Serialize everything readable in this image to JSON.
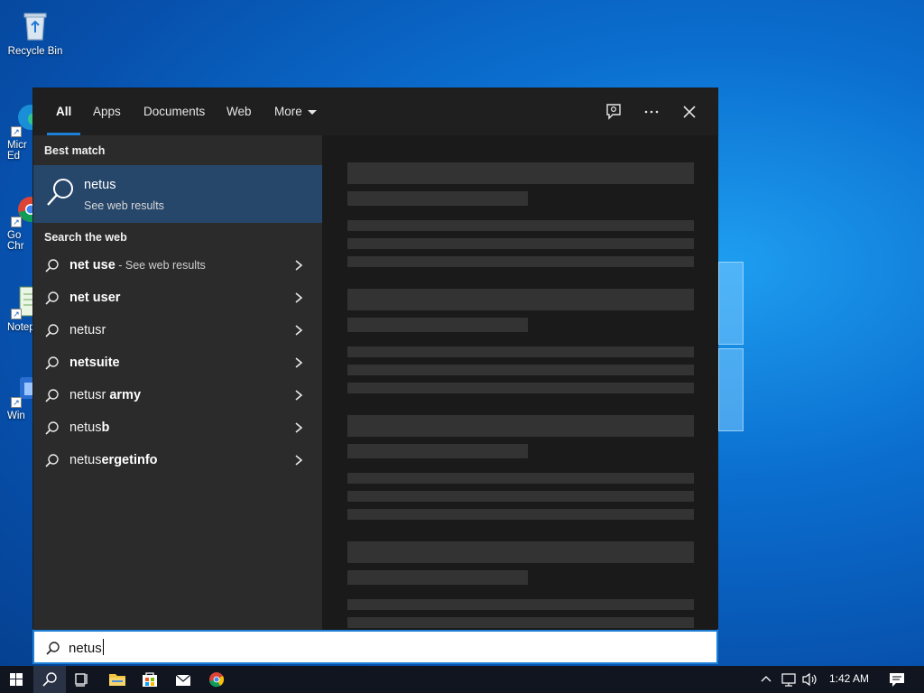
{
  "desktop": {
    "icons": [
      {
        "label": "Recycle Bin"
      },
      {
        "label": "Micr\nEd"
      },
      {
        "label": "Go\nChr"
      },
      {
        "label": "Notep"
      },
      {
        "label": "Win"
      }
    ]
  },
  "search_panel": {
    "tabs": [
      {
        "label": "All",
        "active": true
      },
      {
        "label": "Apps"
      },
      {
        "label": "Documents"
      },
      {
        "label": "Web"
      },
      {
        "label": "More"
      }
    ],
    "best_match": {
      "heading": "Best match",
      "title": "netus",
      "subtitle": "See web results"
    },
    "web_section": {
      "heading": "Search the web",
      "suggestions": [
        {
          "bold": "net use",
          "plain": "",
          "hint": " - See web results"
        },
        {
          "bold": "net user",
          "plain": "",
          "hint": ""
        },
        {
          "bold": "",
          "plain": "netusr",
          "hint": ""
        },
        {
          "bold": "netsuite",
          "plain": "",
          "hint": ""
        },
        {
          "bold": " army",
          "plain": "netusr",
          "hint": ""
        },
        {
          "bold": "b",
          "plain": "netus",
          "hint": ""
        },
        {
          "bold": "ergetinfo",
          "plain": "netus",
          "hint": ""
        }
      ]
    },
    "query": "netus"
  },
  "taskbar": {
    "time": "1:42 AM"
  },
  "colors": {
    "accent": "#1d7fd6",
    "selected_bg": "#26466a",
    "panel_bg": "#2b2b2b"
  }
}
